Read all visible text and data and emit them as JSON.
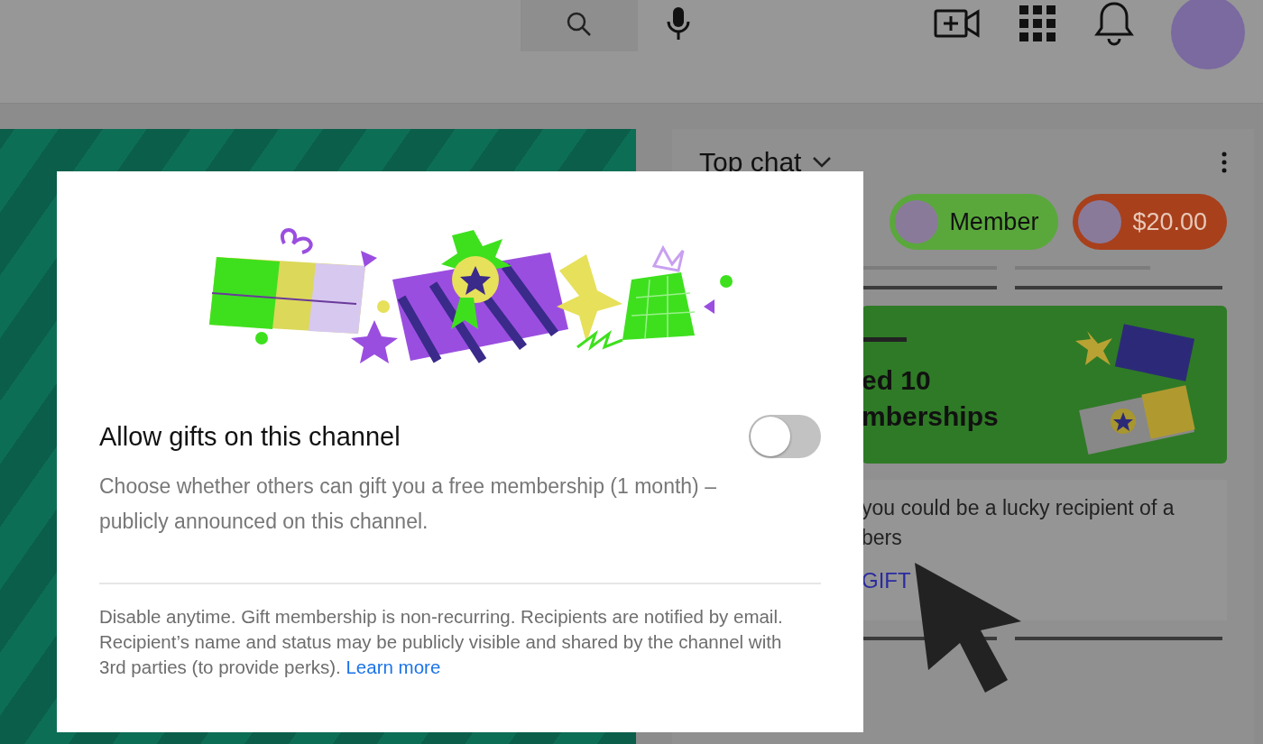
{
  "chat": {
    "title": "Top chat",
    "chips": [
      {
        "kind": "member",
        "label": "Member"
      },
      {
        "kind": "donation",
        "label": "$20.00"
      }
    ],
    "gift_banner": {
      "line_1": "ed 10",
      "line_2": "mberships"
    },
    "info_card": {
      "line_1": "you could be a lucky recipient of a",
      "line_2": "bers",
      "link": "GIFT"
    }
  },
  "dialog": {
    "title": "Allow gifts on this channel",
    "toggle": {
      "on": false
    },
    "description": "Choose whether others can gift you a free membership (1 month) – publicly announced on this channel.",
    "footnote": {
      "text": "Disable anytime. Gift membership is non-recurring. Recipients are notified by email. Recipient’s name and status may be publicly visible and shared by the channel with 3rd parties (to provide perks).",
      "link": "Learn more"
    }
  }
}
